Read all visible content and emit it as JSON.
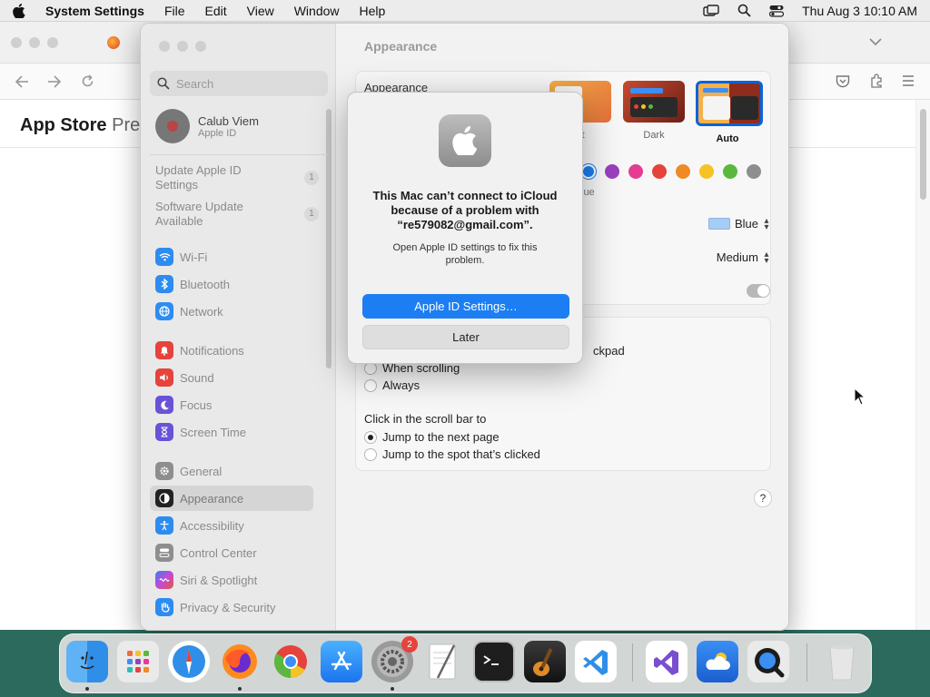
{
  "menubar": {
    "app": "System Settings",
    "items": [
      "File",
      "Edit",
      "View",
      "Window",
      "Help"
    ],
    "clock": "Thu Aug 3  10:10 AM"
  },
  "browser": {
    "page_title": "App Store",
    "page_title_suffix": "Prev"
  },
  "sidebar": {
    "search_placeholder": "Search",
    "user_name": "Calub Viem",
    "user_sub": "Apple ID",
    "update_apple_id": "Update Apple ID Settings",
    "update_apple_id_count": "1",
    "software_update": "Software Update Available",
    "software_update_count": "1",
    "items": [
      {
        "label": "Wi-Fi",
        "icon": "wifi-icon",
        "color": "#2d8cf0"
      },
      {
        "label": "Bluetooth",
        "icon": "bluetooth-icon",
        "color": "#2d8cf0"
      },
      {
        "label": "Network",
        "icon": "globe-icon",
        "color": "#2d8cf0"
      },
      {
        "label": "Notifications",
        "icon": "bell-icon",
        "color": "#e5433b"
      },
      {
        "label": "Sound",
        "icon": "speaker-icon",
        "color": "#e5433b"
      },
      {
        "label": "Focus",
        "icon": "moon-icon",
        "color": "#6a52d8"
      },
      {
        "label": "Screen Time",
        "icon": "hourglass-icon",
        "color": "#6a52d8"
      },
      {
        "label": "General",
        "icon": "gear-icon",
        "color": "#8e8e8e"
      },
      {
        "label": "Appearance",
        "icon": "appearance-icon",
        "color": "#222222"
      },
      {
        "label": "Accessibility",
        "icon": "accessibility-icon",
        "color": "#2d8cf0"
      },
      {
        "label": "Control Center",
        "icon": "control-center-icon",
        "color": "#8e8e8e"
      },
      {
        "label": "Siri & Spotlight",
        "icon": "siri-icon",
        "color": "#b64ad6"
      },
      {
        "label": "Privacy & Security",
        "icon": "hand-icon",
        "color": "#2d8cf0"
      }
    ],
    "selected": "Appearance"
  },
  "content": {
    "header": "Appearance",
    "appearance_label": "Appearance",
    "options": [
      {
        "label": "ht"
      },
      {
        "label": "Dark"
      },
      {
        "label": "Auto"
      }
    ],
    "accent_partial_label": "lue",
    "accent_colors": [
      "#1c7ef2",
      "#9a3fbf",
      "#e43c92",
      "#e5433b",
      "#f08a24",
      "#f6c325",
      "#5bb83e",
      "#8e8e8e"
    ],
    "highlight_value": "Blue",
    "sidebar_icon_size_value": "Medium",
    "scrollbars_partial": "ckpad",
    "radio_when_scrolling": "When scrolling",
    "radio_always": "Always",
    "click_scroll_label": "Click in the scroll bar to",
    "radio_next_page": "Jump to the next page",
    "radio_spot_clicked": "Jump to the spot that’s clicked",
    "help": "?"
  },
  "dialog": {
    "message": "This Mac can’t connect to iCloud because of a problem with “re579082@gmail.com”.",
    "sub": "Open Apple ID settings to fix this problem.",
    "primary_button": "Apple ID Settings…",
    "secondary_button": "Later"
  },
  "dock": {
    "settings_badge": "2",
    "apps": [
      "Finder",
      "Launchpad",
      "Safari",
      "Firefox",
      "Chrome",
      "App Store",
      "System Settings",
      "TextEdit",
      "Terminal",
      "GarageBand",
      "VS Code",
      "Visual Studio",
      "Weather",
      "QuickTime",
      "Trash"
    ]
  }
}
